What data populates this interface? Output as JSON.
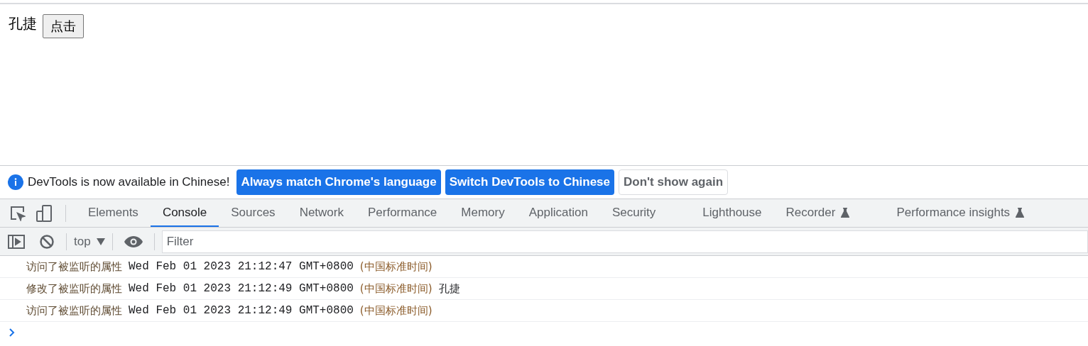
{
  "page": {
    "label": "孔捷",
    "button": "点击"
  },
  "banner": {
    "message": "DevTools is now available in Chinese!",
    "buttons": [
      {
        "label": "Always match Chrome's language",
        "kind": "primary"
      },
      {
        "label": "Switch DevTools to Chinese",
        "kind": "primary"
      },
      {
        "label": "Don't show again",
        "kind": "secondary"
      }
    ]
  },
  "tabs": [
    {
      "label": "Elements",
      "selected": false,
      "experimental": false
    },
    {
      "label": "Console",
      "selected": true,
      "experimental": false
    },
    {
      "label": "Sources",
      "selected": false,
      "experimental": false
    },
    {
      "label": "Network",
      "selected": false,
      "experimental": false
    },
    {
      "label": "Performance",
      "selected": false,
      "experimental": false
    },
    {
      "label": "Memory",
      "selected": false,
      "experimental": false
    },
    {
      "label": "Application",
      "selected": false,
      "experimental": false
    },
    {
      "label": "Security",
      "selected": false,
      "experimental": false
    },
    {
      "label": "Lighthouse",
      "selected": false,
      "experimental": false
    },
    {
      "label": "Recorder",
      "selected": false,
      "experimental": true
    },
    {
      "label": "Performance insights",
      "selected": false,
      "experimental": true
    }
  ],
  "console_toolbar": {
    "context": "top",
    "filter": {
      "placeholder": "Filter"
    }
  },
  "console": [
    {
      "message": "访问了被监听的属性",
      "date": "Wed Feb 01 2023 21:12:47 GMT+0800",
      "zone": "(中国标准时间)"
    },
    {
      "message": "修改了被监听的属性",
      "date": "Wed Feb 01 2023 21:12:49 GMT+0800",
      "zone": "(中国标准时间)",
      "value": "孔捷"
    },
    {
      "message": "访问了被监听的属性",
      "date": "Wed Feb 01 2023 21:12:49 GMT+0800",
      "zone": "(中国标准时间)"
    }
  ]
}
